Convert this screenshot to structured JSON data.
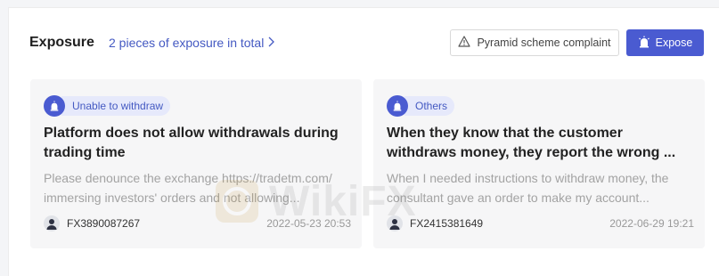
{
  "header": {
    "title": "Exposure",
    "count_link": "2 pieces of exposure in total",
    "complaint_button": "Pyramid scheme complaint",
    "expose_button": "Expose"
  },
  "cards": [
    {
      "tag": "Unable to withdraw",
      "title": "Platform does not allow withdrawals during trading time",
      "body": "Please denounce the exchange https://tradetm.com/ immersing investors' orders and not allowing...",
      "user": "FX3890087267",
      "time": "2022-05-23 20:53"
    },
    {
      "tag": "Others",
      "title": "When they know that the customer withdraws money, they report the wrong ...",
      "body": "When I needed instructions to withdraw money, the consultant gave an order to make my account...",
      "user": "FX2415381649",
      "time": "2022-06-29 19:21"
    }
  ],
  "watermark": "WikiFX",
  "colors": {
    "accent": "#4a5bd1",
    "tag_bg": "#e6e9fb",
    "card_bg": "#f6f6f7"
  }
}
